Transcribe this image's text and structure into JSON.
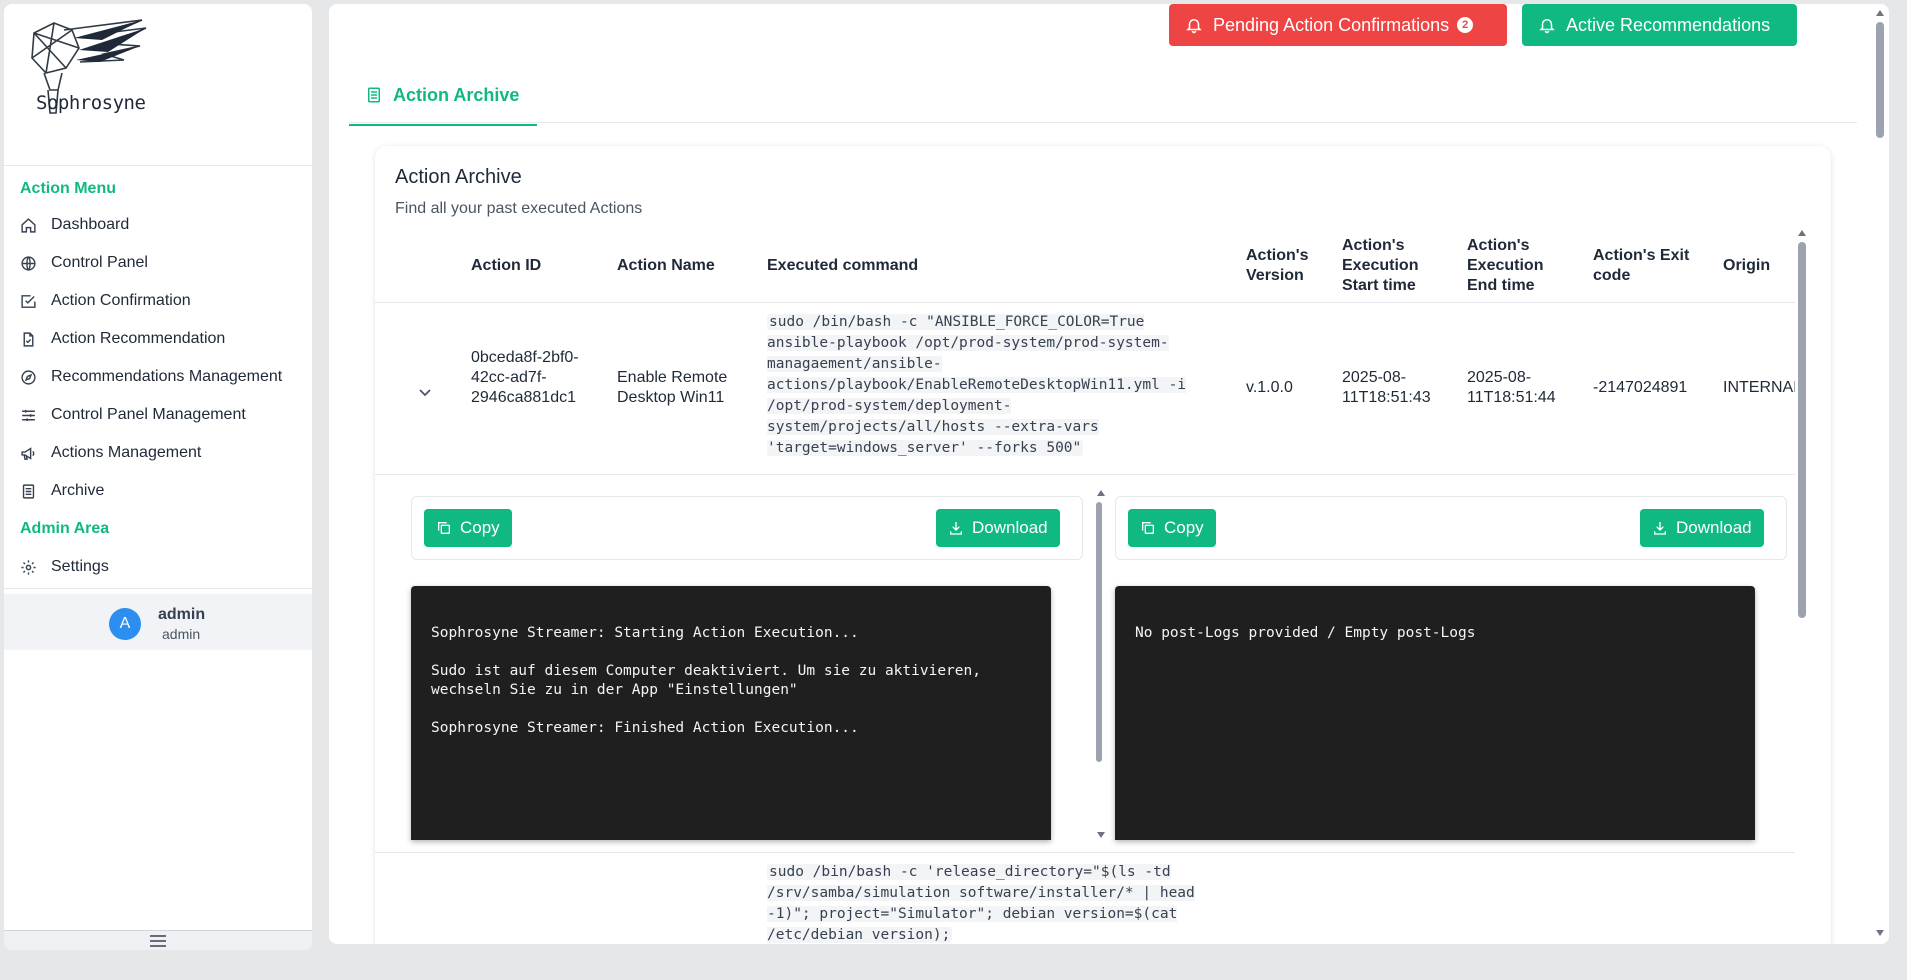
{
  "app": {
    "logo_text": "Sophrosyne"
  },
  "sidebar": {
    "section_action_menu": "Action Menu",
    "section_admin_area": "Admin Area",
    "items": [
      {
        "label": "Dashboard",
        "icon": "home-icon"
      },
      {
        "label": "Control Panel",
        "icon": "globe-icon"
      },
      {
        "label": "Action Confirmation",
        "icon": "check-square-icon"
      },
      {
        "label": "Action Recommendation",
        "icon": "file-check-icon"
      },
      {
        "label": "Recommendations Management",
        "icon": "compass-icon"
      },
      {
        "label": "Control Panel Management",
        "icon": "sliders-icon"
      },
      {
        "label": "Actions Management",
        "icon": "megaphone-icon"
      },
      {
        "label": "Archive",
        "icon": "archive-list-icon"
      }
    ],
    "admin_items": [
      {
        "label": "Settings",
        "icon": "gear-icon"
      }
    ],
    "user": {
      "initial": "A",
      "name": "admin",
      "role": "admin"
    }
  },
  "header": {
    "pending_label": "Pending Action Confirmations",
    "pending_count": "2",
    "active_label": "Active Recommendations",
    "tab_label": "Action Archive"
  },
  "card": {
    "title": "Action Archive",
    "subtitle": "Find all your past executed Actions"
  },
  "table": {
    "columns": [
      "Action ID",
      "Action Name",
      "Executed command",
      "Action's Version",
      "Action's Execution Start time",
      "Action's Execution End time",
      "Action's Exit code",
      "Origin"
    ],
    "rows": [
      {
        "id": "0bceda8f-2bf0-42cc-ad7f-2946ca881dc1",
        "name": "Enable Remote Desktop Win11",
        "command": "sudo /bin/bash -c \"ANSIBLE_FORCE_COLOR=True ansible-playbook /opt/prod-system/prod-system-managaement/ansible-actions/playbook/EnableRemoteDesktopWin11.yml -i /opt/prod-system/deployment-system/projects/all/hosts --extra-vars 'target=windows_server' --forks 500\"",
        "version": "v.1.0.0",
        "start": "2025-08-11T18:51:43",
        "end": "2025-08-11T18:51:44",
        "exit_code": "-2147024891",
        "origin": "INTERNAL"
      },
      {
        "command": "sudo /bin/bash -c 'release_directory=\"$(ls -td /srv/samba/simulation software/installer/* | head -1)\"; project=\"Simulator\"; debian version=$(cat /etc/debian version);"
      }
    ]
  },
  "logs": {
    "copy_label": "Copy",
    "download_label": "Download",
    "pre_log": "Sophrosyne Streamer: Starting Action Execution...\n\nSudo ist auf diesem Computer deaktiviert. Um sie zu aktivieren, wechseln Sie zu in der App \"Einstellungen\"\n\nSophrosyne Streamer: Finished Action Execution...",
    "post_log": "No post-Logs provided / Empty post-Logs"
  }
}
